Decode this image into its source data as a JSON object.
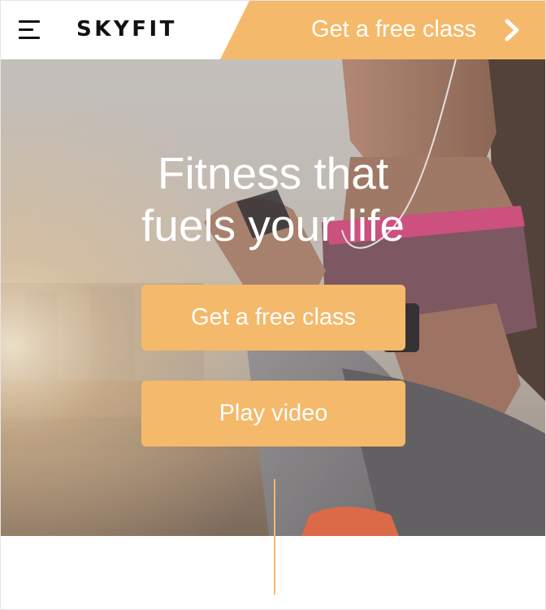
{
  "header": {
    "menu_icon": "hamburger-menu-icon",
    "logo_text": "SKYFIT",
    "cta_label": "Get a free class",
    "cta_icon": "chevron-right-icon"
  },
  "hero": {
    "headline_line1": "Fitness that",
    "headline_line2": "fuels your life",
    "primary_button_label": "Get a free class",
    "secondary_button_label": "Play video"
  },
  "colors": {
    "accent": "#f4b96a",
    "text_dark": "#111111",
    "text_light": "#ffffff"
  }
}
